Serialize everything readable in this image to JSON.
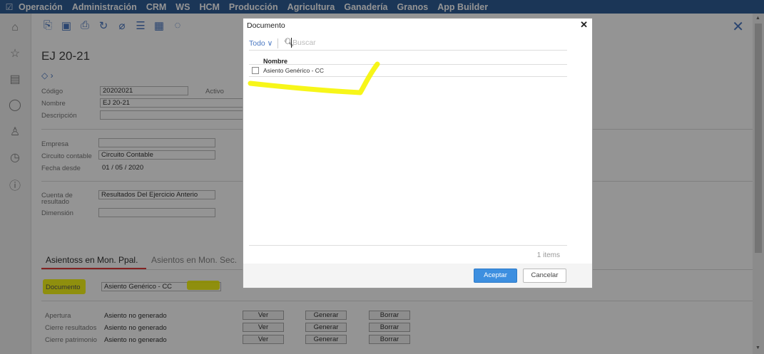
{
  "topbar": {
    "menu": [
      "Operación",
      "Administración",
      "CRM",
      "WS",
      "HCM",
      "Producción",
      "Agricultura",
      "Ganadería",
      "Granos",
      "App Builder"
    ]
  },
  "record": {
    "title": "EJ 20-21",
    "fields": {
      "codigo_label": "Código",
      "codigo_value": "20202021",
      "activo_label": "Activo",
      "nombre_label": "Nombre",
      "nombre_value": "EJ 20-21",
      "descripcion_label": "Descripción",
      "empresa_label": "Empresa",
      "circuito_label": "Circuito contable",
      "circuito_value": "Circuito Contable",
      "fecha_label": "Fecha desde",
      "fecha_value": "01 / 05 / 2020",
      "cuenta_label": "Cuenta de resultado",
      "cuenta_value": "Resultados Del Ejercicio Anterio",
      "dimension_label": "Dimensión"
    },
    "tabs": [
      "Asientoss en Mon. Ppal.",
      "Asientos en Mon. Sec."
    ],
    "documento_label": "Documento",
    "documento_value": "Asiento Genérico - CC",
    "asientos": [
      {
        "label": "Apertura",
        "status": "Asiento no generado",
        "ver": "Ver",
        "generar": "Generar",
        "borrar": "Borrar"
      },
      {
        "label": "Cierre resultados",
        "status": "Asiento no generado",
        "ver": "Ver",
        "generar": "Generar",
        "borrar": "Borrar"
      },
      {
        "label": "Cierre patrimonio",
        "status": "Asiento no generado",
        "ver": "Ver",
        "generar": "Generar",
        "borrar": "Borrar"
      }
    ]
  },
  "modal": {
    "title": "Documento",
    "filter": "Todo ∨",
    "search_placeholder": "Buscar",
    "column": "Nombre",
    "rows": [
      "Asiento Genérico - CC"
    ],
    "count": "1 items",
    "accept": "Aceptar",
    "cancel": "Cancelar"
  },
  "colors": {
    "topbar": "#2f5d97",
    "accent": "#4a78c2",
    "tab_underline": "#e03c3c",
    "highlight": "#f6f500",
    "accept_button": "#3d8fe0"
  }
}
